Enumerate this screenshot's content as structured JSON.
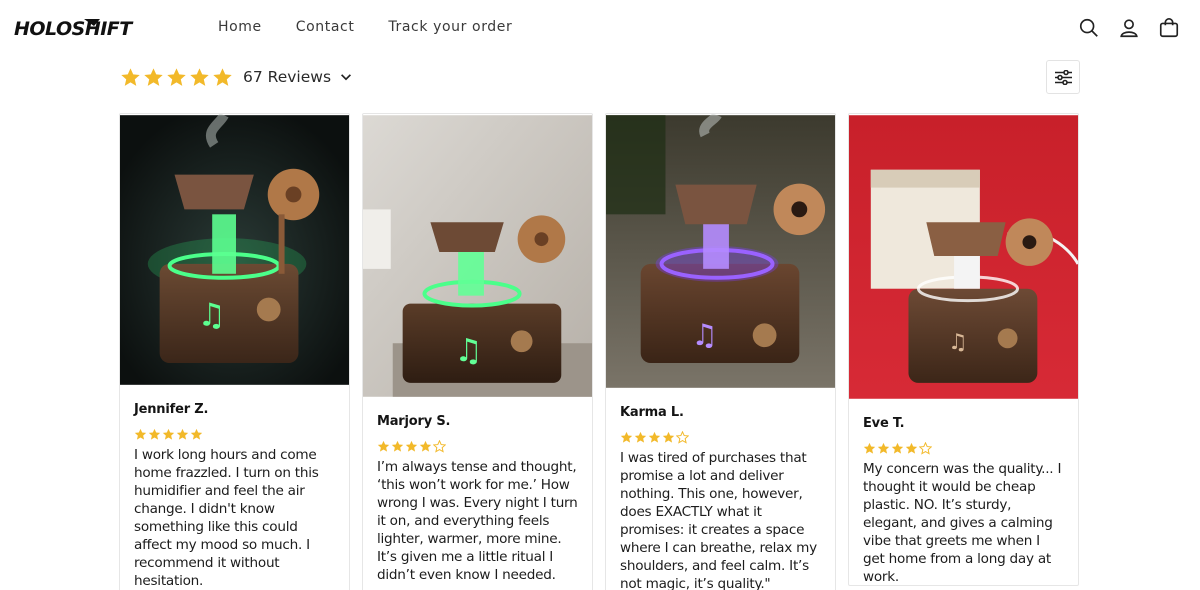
{
  "header": {
    "logo_text": "HOLOSHIFT",
    "nav": [
      {
        "label": "Home"
      },
      {
        "label": "Contact"
      },
      {
        "label": "Track your order"
      }
    ],
    "icons": [
      "search-icon",
      "account-icon",
      "cart-icon"
    ]
  },
  "summary": {
    "average_rating": 5,
    "review_count_label": "67 Reviews",
    "star_color": "#f2b92a"
  },
  "reviews": [
    {
      "author": "Jennifer Z.",
      "rating": 5,
      "text": "I work long hours and come home frazzled. I turn on this humidifier and feel the air change. I didn't know something like this could affect my mood so much. I recommend it without hesitation."
    },
    {
      "author": "Marjory S.",
      "rating": 4,
      "text": "I’m always tense and thought, ‘this won’t work for me.’ How wrong I was. Every night I turn it on, and everything feels lighter, warmer, more mine. It’s given me a little ritual I didn’t even know I needed."
    },
    {
      "author": "Karma L.",
      "rating": 4,
      "text": "I was tired of purchases that promise a lot and deliver nothing. This one, however, does EXACTLY what it promises: it creates a space where I can breathe, relax my shoulders, and feel calm. It’s not magic, it’s quality.\""
    },
    {
      "author": "Eve T.",
      "rating": 4,
      "text": "My concern was the quality... I thought it would be cheap plastic. NO. It’s sturdy, elegant, and gives a calming vibe that greets me when I get home from a long day at work."
    }
  ]
}
